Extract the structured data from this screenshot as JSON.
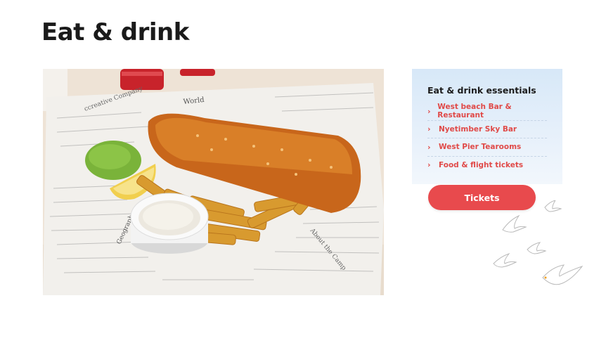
{
  "page": {
    "title": "Eat & drink"
  },
  "essentials": {
    "heading": "Eat & drink essentials",
    "links": [
      {
        "label": "West beach Bar & Restaurant"
      },
      {
        "label": "Nyetimber Sky Bar"
      },
      {
        "label": "West Pier Tearooms"
      },
      {
        "label": "Food & flight tickets"
      }
    ]
  },
  "cta": {
    "label": "Tickets"
  },
  "colors": {
    "accent": "#e84a4d",
    "panel_bg": "#d7e8f8"
  },
  "icons": [
    "chevron-right-icon",
    "seagull-icon"
  ]
}
